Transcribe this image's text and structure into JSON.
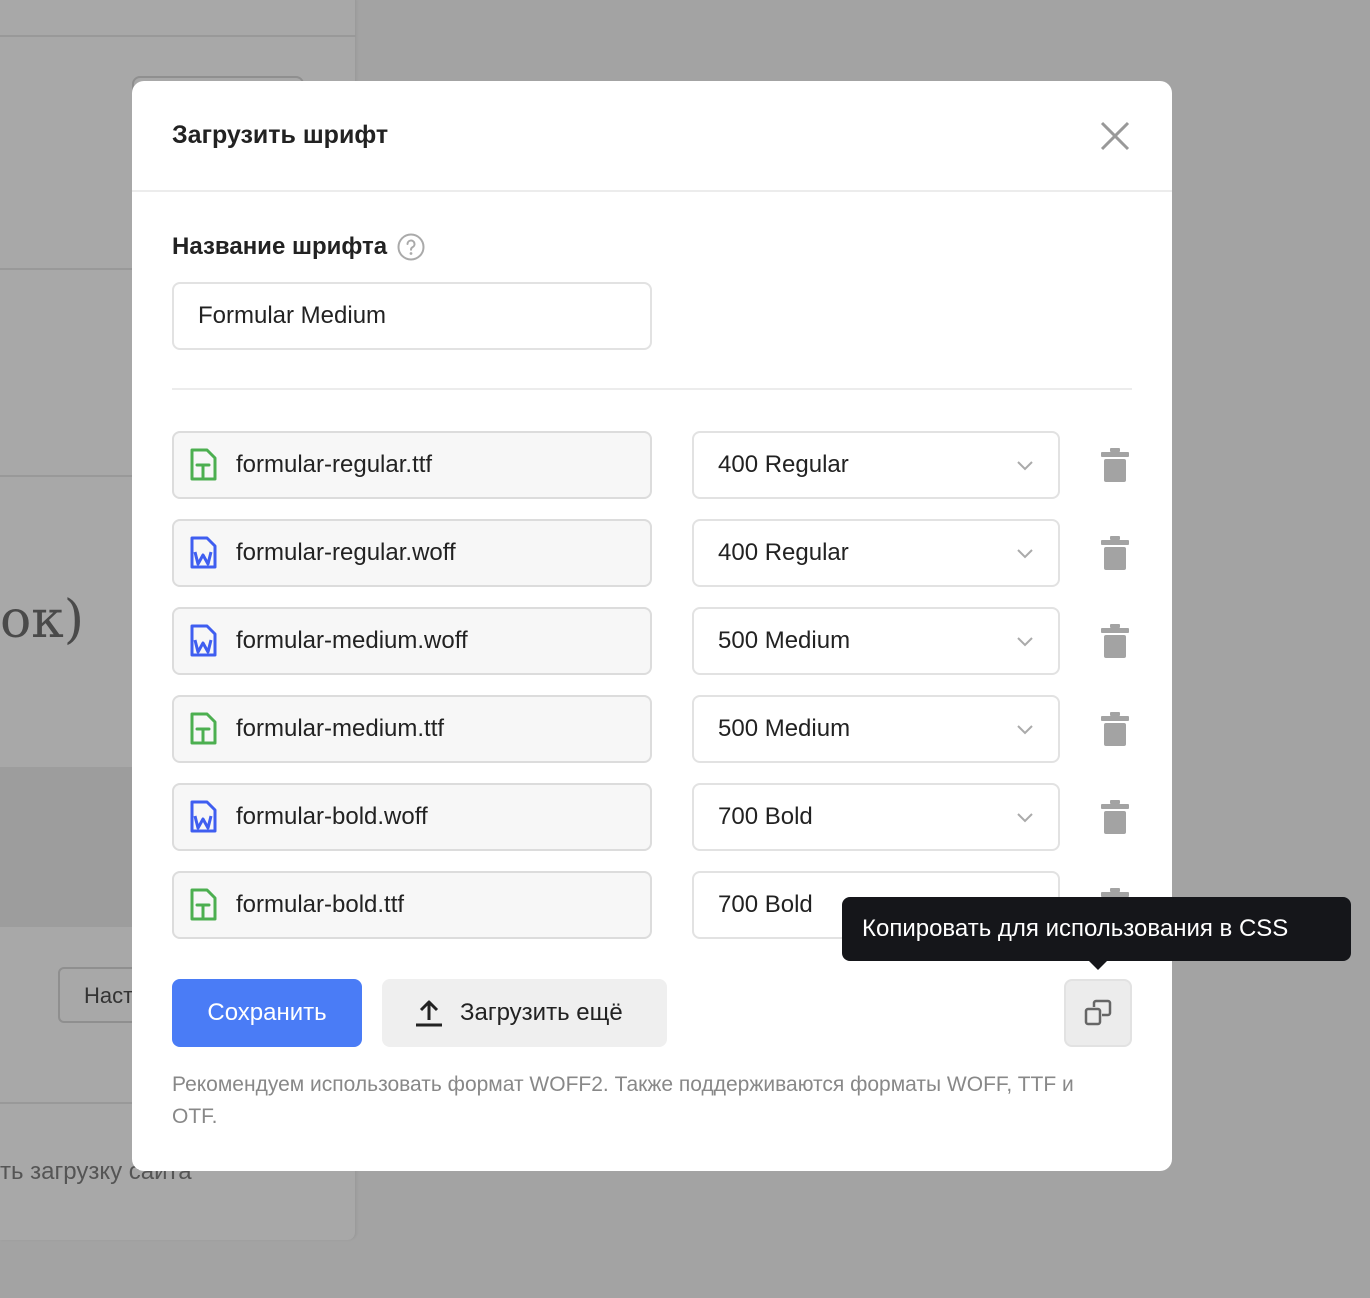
{
  "background": {
    "heading_fragment": "ок)",
    "button_fragment": "Настр",
    "text_fragment": "ть загрузку сайта"
  },
  "modal": {
    "title": "Загрузить шрифт",
    "close_icon": "close-icon",
    "font_name_label": "Название шрифта",
    "font_name_value": "Formular Medium",
    "files": [
      {
        "name": "formular-regular.ttf",
        "type": "ttf",
        "weight": "400 Regular"
      },
      {
        "name": "formular-regular.woff",
        "type": "woff",
        "weight": "400 Regular"
      },
      {
        "name": "formular-medium.woff",
        "type": "woff",
        "weight": "500 Medium"
      },
      {
        "name": "formular-medium.ttf",
        "type": "ttf",
        "weight": "500 Medium"
      },
      {
        "name": "formular-bold.woff",
        "type": "woff",
        "weight": "700 Bold"
      },
      {
        "name": "formular-bold.ttf",
        "type": "ttf",
        "weight": "700 Bold"
      }
    ],
    "save_label": "Сохранить",
    "upload_more_label": "Загрузить ещё",
    "hint": "Рекомендуем использовать формат WOFF2. Также поддерживаются форматы WOFF, TTF и OTF.",
    "tooltip": "Копировать для использования в CSS"
  },
  "colors": {
    "accent": "#4a7cf6",
    "ttf_icon": "#4caf50",
    "woff_icon": "#3f5ef0",
    "overlay": "#a3a3a3"
  }
}
